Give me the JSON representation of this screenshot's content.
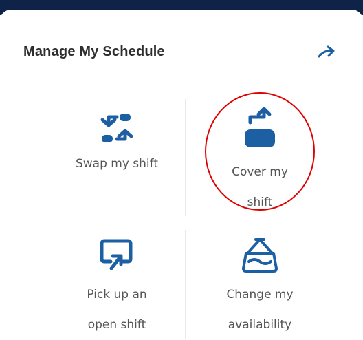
{
  "card": {
    "title": "Manage My Schedule",
    "title_icon": "arrow-right-icon"
  },
  "actions": [
    {
      "label_line1": "Swap my shift",
      "label_line2": "",
      "icon": "swap-arrows-icon"
    },
    {
      "label_line1": "Cover my",
      "label_line2": "shift",
      "icon": "cover-shift-icon"
    },
    {
      "label_line1": "Pick up an",
      "label_line2": "open shift",
      "icon": "pick-up-shift-icon"
    },
    {
      "label_line1": "Change my",
      "label_line2": "availability",
      "icon": "availability-sign-icon"
    }
  ],
  "colors": {
    "accent": "#1c5fa3",
    "topbar": "#0f2348",
    "highlight": "#e00000"
  }
}
